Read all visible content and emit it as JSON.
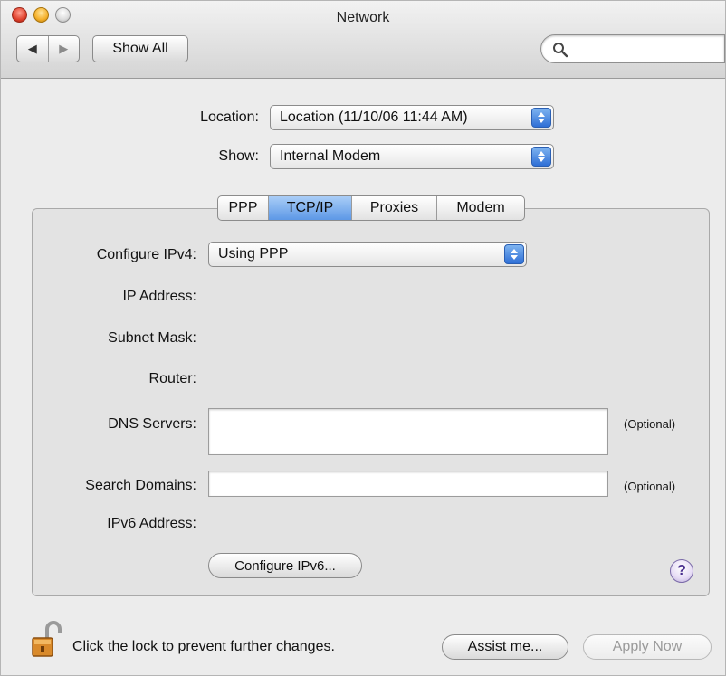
{
  "window": {
    "title": "Network"
  },
  "toolbar": {
    "back_glyph": "◀",
    "forward_glyph": "▶",
    "show_all_label": "Show All",
    "search_placeholder": ""
  },
  "location": {
    "label": "Location:",
    "value": "Location (11/10/06 11:44 AM)"
  },
  "show": {
    "label": "Show:",
    "value": "Internal Modem"
  },
  "tabs": [
    {
      "label": "PPP",
      "active": false
    },
    {
      "label": "TCP/IP",
      "active": true
    },
    {
      "label": "Proxies",
      "active": false
    },
    {
      "label": "Modem",
      "active": false
    }
  ],
  "tcpip": {
    "configure_ipv4_label": "Configure IPv4:",
    "configure_ipv4_value": "Using PPP",
    "ip_address_label": "IP Address:",
    "subnet_mask_label": "Subnet Mask:",
    "router_label": "Router:",
    "dns_servers_label": "DNS Servers:",
    "dns_servers_value": "",
    "dns_optional": "(Optional)",
    "search_domains_label": "Search Domains:",
    "search_domains_value": "",
    "search_optional": "(Optional)",
    "ipv6_address_label": "IPv6 Address:",
    "configure_ipv6_button": "Configure IPv6...",
    "help_glyph": "?"
  },
  "footer": {
    "lock_text": "Click the lock to prevent further changes.",
    "assist_button": "Assist me...",
    "apply_button": "Apply Now"
  },
  "icons": {
    "close": "close-icon",
    "minimize": "minimize-icon",
    "zoom": "zoom-icon",
    "search": "search-icon",
    "lock": "lock-open-icon",
    "help": "help-icon"
  }
}
